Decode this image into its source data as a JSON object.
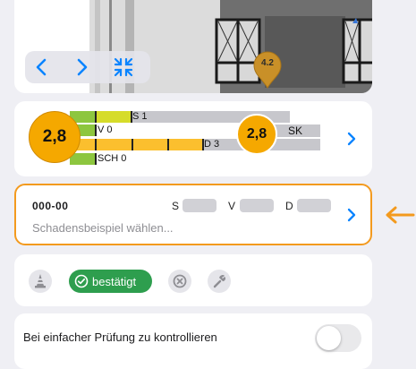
{
  "image_card": {
    "pin_label": "4.2",
    "icons": [
      "chevron-left-icon",
      "chevron-right-icon",
      "collapse-icon",
      "location-pin-icon"
    ]
  },
  "rating": {
    "bars": [
      {
        "label": "S 1",
        "level": 1
      },
      {
        "label": "V 0",
        "level": 0
      },
      {
        "label": "D 3",
        "level": 3
      },
      {
        "label": "SCH 0",
        "level": 0
      }
    ],
    "score_left": "2,8",
    "score_right": "2,8",
    "sk_label": "SK",
    "colors": {
      "green": "#8dc63f",
      "yellow": "#d6dc2a",
      "orange": "#fbbf2e",
      "score": "#f5a800",
      "gray": "#c7c7cc"
    }
  },
  "damage": {
    "code": "000-00",
    "s_label": "S",
    "v_label": "V",
    "d_label": "D",
    "hint": "Schadensbeispiel wählen...",
    "accent": "#f39a1e"
  },
  "status": {
    "confirmed_label": "bestätigt",
    "icons": [
      "traffic-cone-icon",
      "check-circle-icon",
      "close-circle-icon",
      "tool-icon"
    ]
  },
  "toggle": {
    "label": "Bei einfacher Prüfung zu kontrollieren",
    "on": false
  }
}
